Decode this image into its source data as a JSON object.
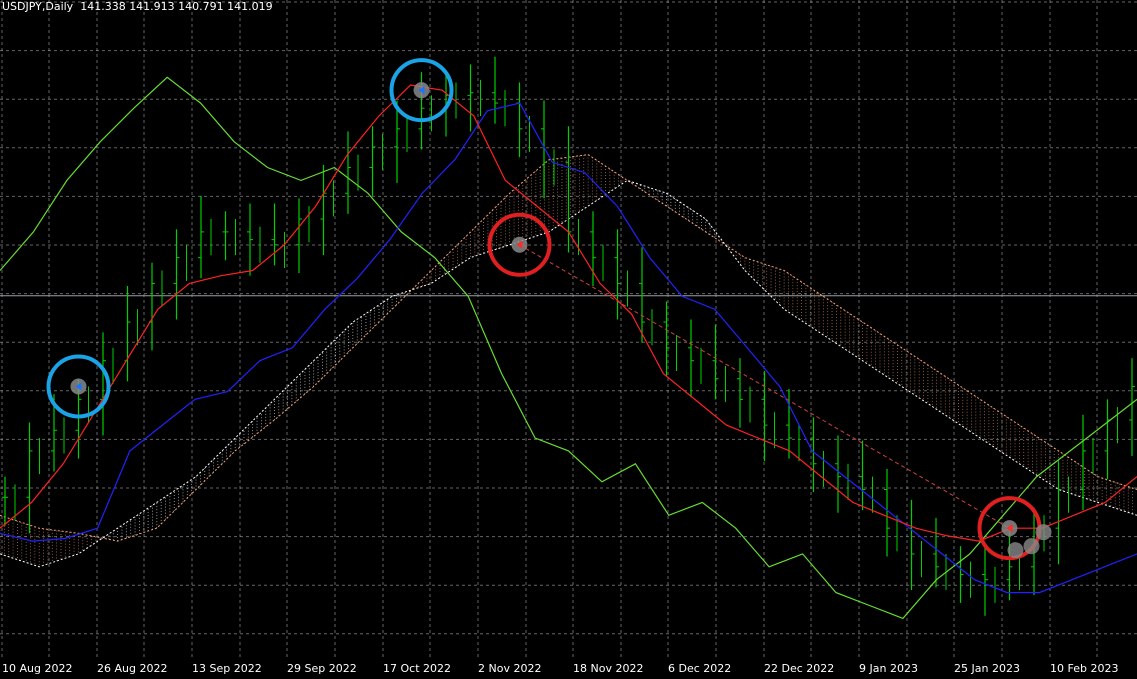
{
  "header": {
    "symbol_label": "USDJPY,Daily",
    "ohlc": "141.338 141.913 140.791 141.019"
  },
  "colors": {
    "background": "#000000",
    "grid": "#b8b8b8",
    "bars": "#00d000",
    "chikou": "#66dd33",
    "tenkan": "#ff2222",
    "kijun": "#2222ff",
    "kumo_bull": "#f4a070",
    "kumo_bear": "#ffffff",
    "marker_circle_blue": "#1aa3e6",
    "marker_circle_red": "#e02020",
    "trendline": "#d04040"
  },
  "chart_data": {
    "type": "line",
    "instrument": "USDJPY",
    "timeframe": "Daily",
    "x_tick_labels": [
      "10 Aug 2022",
      "26 Aug 2022",
      "13 Sep 2022",
      "29 Sep 2022",
      "17 Oct 2022",
      "2 Nov 2022",
      "18 Nov 2022",
      "6 Dec 2022",
      "22 Dec 2022",
      "9 Jan 2023",
      "25 Jan 2023",
      "10 Feb 2023"
    ],
    "ylim": [
      127.0,
      152.5
    ],
    "grid": true,
    "current_price_line": 141.02,
    "series": [
      {
        "name": "",
        "kind": "price",
        "values": [
          133.2,
          135.0,
          135.8,
          137.0,
          138.5,
          140.0,
          141.5,
          142.5,
          143.5,
          143.5,
          143.2,
          143.0,
          144.0,
          145.0,
          146.0,
          146.8,
          147.5,
          148.3,
          148.8,
          148.9,
          148.5,
          147.5,
          146.2,
          143.5,
          142.5,
          141.5,
          140.0,
          139.0,
          138.5,
          137.8,
          137.0,
          136.0,
          135.5,
          134.5,
          134.0,
          133.5,
          132.0,
          131.0,
          130.5,
          130.2,
          130.0,
          130.5,
          132.0,
          133.5,
          135.0,
          136.2,
          137.5
        ]
      },
      {
        "name": "",
        "kind": "tenkan",
        "values": [
          132.0,
          133.0,
          134.5,
          136.5,
          138.5,
          140.5,
          141.5,
          141.8,
          142.0,
          143.0,
          144.5,
          146.5,
          148.0,
          149.2,
          149.0,
          148.0,
          145.5,
          144.5,
          143.5,
          141.5,
          140.3,
          138.0,
          137.0,
          136.0,
          135.5,
          135.0,
          134.0,
          133.0,
          132.5,
          132.0,
          131.7,
          131.5,
          132.0,
          132.0,
          132.5,
          133.0,
          134.0
        ]
      },
      {
        "name": "",
        "kind": "kijun",
        "values": [
          131.8,
          131.5,
          131.6,
          132.0,
          135.0,
          136.0,
          137.0,
          137.3,
          138.5,
          139.0,
          140.5,
          141.7,
          143.2,
          145.0,
          146.3,
          148.2,
          148.5,
          146.2,
          145.8,
          144.5,
          142.5,
          141.0,
          140.5,
          139.0,
          137.5,
          135.0,
          134.0,
          133.0,
          132.0,
          131.0,
          130.0,
          129.5,
          129.5,
          130.0,
          130.5,
          131.0
        ]
      },
      {
        "name": "",
        "kind": "chikou",
        "values": [
          142.0,
          143.5,
          145.5,
          147.0,
          148.3,
          149.5,
          148.5,
          147.0,
          146.0,
          145.5,
          146.0,
          145.0,
          143.5,
          142.5,
          141.0,
          138.0,
          135.5,
          135.0,
          133.8,
          134.5,
          132.5,
          133.0,
          132.0,
          130.5,
          131.0,
          129.5,
          129.0,
          128.5,
          130.0,
          131.0,
          132.5,
          134.0,
          135.0,
          136.0,
          137.0
        ]
      },
      {
        "name": "",
        "kind": "kumo_span_a",
        "values": [
          132.5,
          132.0,
          131.8,
          131.5,
          132.0,
          133.5,
          135.0,
          136.2,
          137.5,
          139.0,
          140.5,
          142.0,
          143.5,
          145.0,
          146.3,
          146.5,
          145.5,
          144.5,
          143.5,
          142.5,
          142.0,
          141.0,
          140.0,
          139.0,
          138.0,
          137.0,
          136.0,
          135.0,
          134.0,
          133.5,
          133.0
        ]
      },
      {
        "name": "",
        "kind": "kumo_span_b",
        "values": [
          131.0,
          130.5,
          131.0,
          132.0,
          133.0,
          134.0,
          135.5,
          137.0,
          138.5,
          140.0,
          141.0,
          141.5,
          142.5,
          143.0,
          143.5,
          144.5,
          145.5,
          145.0,
          144.0,
          142.0,
          140.5,
          139.5,
          138.5,
          137.5,
          136.5,
          135.5,
          134.5,
          133.5,
          133.0,
          132.5
        ]
      }
    ],
    "annotations": [
      {
        "shape": "circle",
        "color": "blue",
        "x_index": 3,
        "y": 137.5
      },
      {
        "shape": "circle",
        "color": "blue",
        "x_index": 17,
        "y": 149.0
      },
      {
        "shape": "circle",
        "color": "red",
        "x_index": 21,
        "y": 143.0
      },
      {
        "shape": "circle",
        "color": "red",
        "x_index": 41,
        "y": 132.0
      }
    ]
  }
}
